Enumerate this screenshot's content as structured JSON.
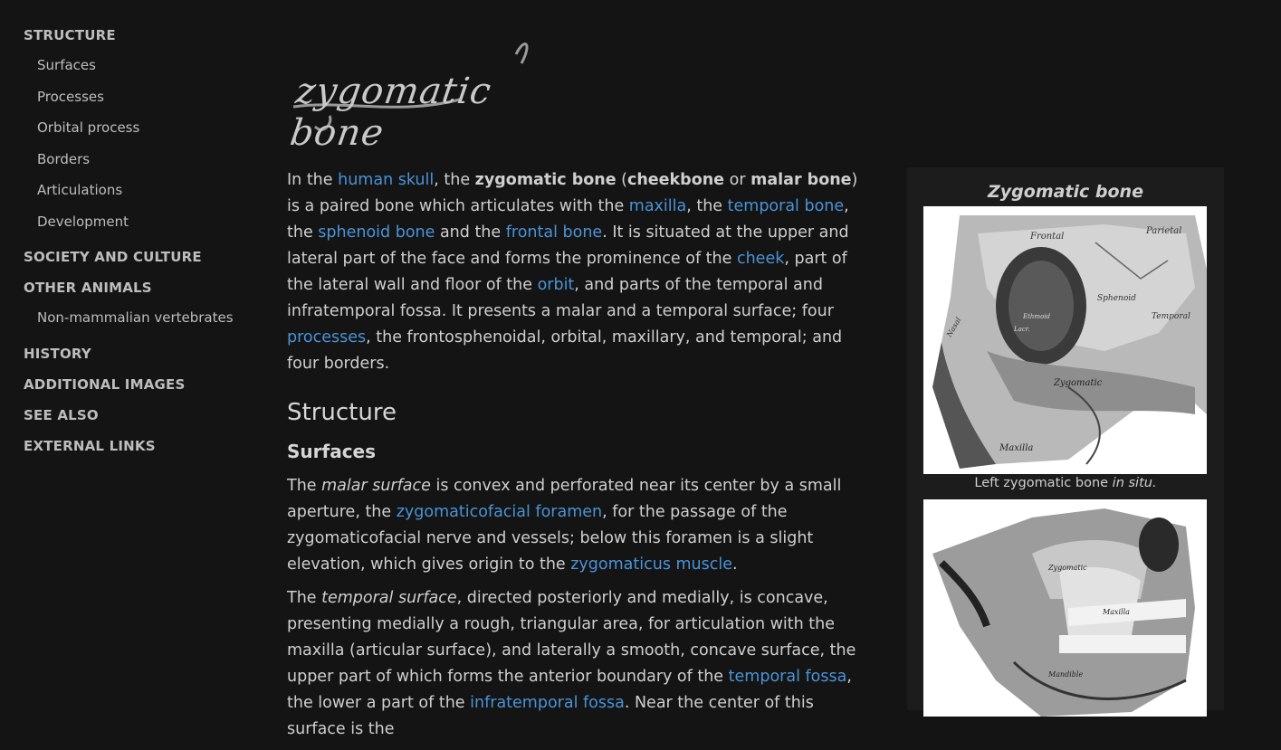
{
  "sidebar": {
    "items": [
      {
        "label": "STRUCTURE",
        "level": 1
      },
      {
        "label": "Surfaces",
        "level": 2
      },
      {
        "label": "Processes",
        "level": 2
      },
      {
        "label": "Orbital process",
        "level": 2
      },
      {
        "label": "Borders",
        "level": 2
      },
      {
        "label": "Articulations",
        "level": 2
      },
      {
        "label": "Development",
        "level": 2
      },
      {
        "label": "SOCIETY AND CULTURE",
        "level": 1
      },
      {
        "label": "OTHER ANIMALS",
        "level": 1
      },
      {
        "label": "Non-mammalian vertebrates",
        "level": 2
      },
      {
        "label": "HISTORY",
        "level": 1
      },
      {
        "label": "ADDITIONAL IMAGES",
        "level": 1
      },
      {
        "label": "SEE ALSO",
        "level": 1
      },
      {
        "label": "EXTERNAL LINKS",
        "level": 1
      }
    ]
  },
  "article": {
    "title": "zygomatic bone",
    "intro": [
      {
        "t": "In the "
      },
      {
        "t": "human skull",
        "link": true
      },
      {
        "t": ", the "
      },
      {
        "t": "zygomatic bone",
        "bold": true
      },
      {
        "t": " ("
      },
      {
        "t": "cheekbone",
        "bold": true
      },
      {
        "t": " or "
      },
      {
        "t": "malar bone",
        "bold": true
      },
      {
        "t": ") is a paired bone which articulates with the "
      },
      {
        "t": "maxilla",
        "link": true
      },
      {
        "t": ", the "
      },
      {
        "t": "temporal bone",
        "link": true
      },
      {
        "t": ", the "
      },
      {
        "t": "sphenoid bone",
        "link": true
      },
      {
        "t": " and the "
      },
      {
        "t": "frontal bone",
        "link": true
      },
      {
        "t": ". It is situated at the upper and lateral part of the face and forms the prominence of the "
      },
      {
        "t": "cheek",
        "link": true
      },
      {
        "t": ", part of the lateral wall and floor of the "
      },
      {
        "t": "orbit",
        "link": true
      },
      {
        "t": ", and parts of the temporal and infratemporal fossa. It presents a malar and a temporal surface; four "
      },
      {
        "t": "processes",
        "link": true
      },
      {
        "t": ", the frontosphenoidal, orbital, maxillary, and temporal; and four borders."
      }
    ],
    "section_heading": "Structure",
    "subsection_heading": "Surfaces",
    "surfaces_p1": [
      {
        "t": "The "
      },
      {
        "t": "malar surface",
        "italic": true
      },
      {
        "t": " is convex and perforated near its center by a small aperture, the "
      },
      {
        "t": "zygomaticofacial foramen",
        "link": true
      },
      {
        "t": ", for the passage of the zygomaticofacial nerve and vessels; below this foramen is a slight elevation, which gives origin to the "
      },
      {
        "t": "zygomaticus muscle",
        "link": true
      },
      {
        "t": "."
      }
    ],
    "surfaces_p2": [
      {
        "t": "The "
      },
      {
        "t": "temporal surface",
        "italic": true
      },
      {
        "t": ", directed posteriorly and medially, is concave, presenting medially a rough, triangular area, for articulation with the maxilla (articular surface), and laterally a smooth, concave surface, the upper part of which forms the anterior boundary of the "
      },
      {
        "t": "temporal fossa",
        "link": true
      },
      {
        "t": ", the lower a part of the "
      },
      {
        "t": "infratemporal fossa",
        "link": true
      },
      {
        "t": ". Near the center of this surface is the"
      }
    ]
  },
  "infobox": {
    "title": "Zygomatic bone",
    "caption_main": "Left zygomatic bone ",
    "caption_italic": "in situ.",
    "img1_labels": {
      "frontal": "Frontal",
      "parietal": "Parietal",
      "sphenoid": "Sphenoid",
      "temporal": "Temporal",
      "zygomatic": "Zygomatic",
      "maxilla": "Maxilla",
      "nasal": "Nasal",
      "ethmoid": "Ethmoid",
      "lacr": "Lacr."
    },
    "img2_labels": {
      "zygomatic": "Zygomatic",
      "maxilla": "Maxilla",
      "mandible": "Mandible"
    }
  }
}
